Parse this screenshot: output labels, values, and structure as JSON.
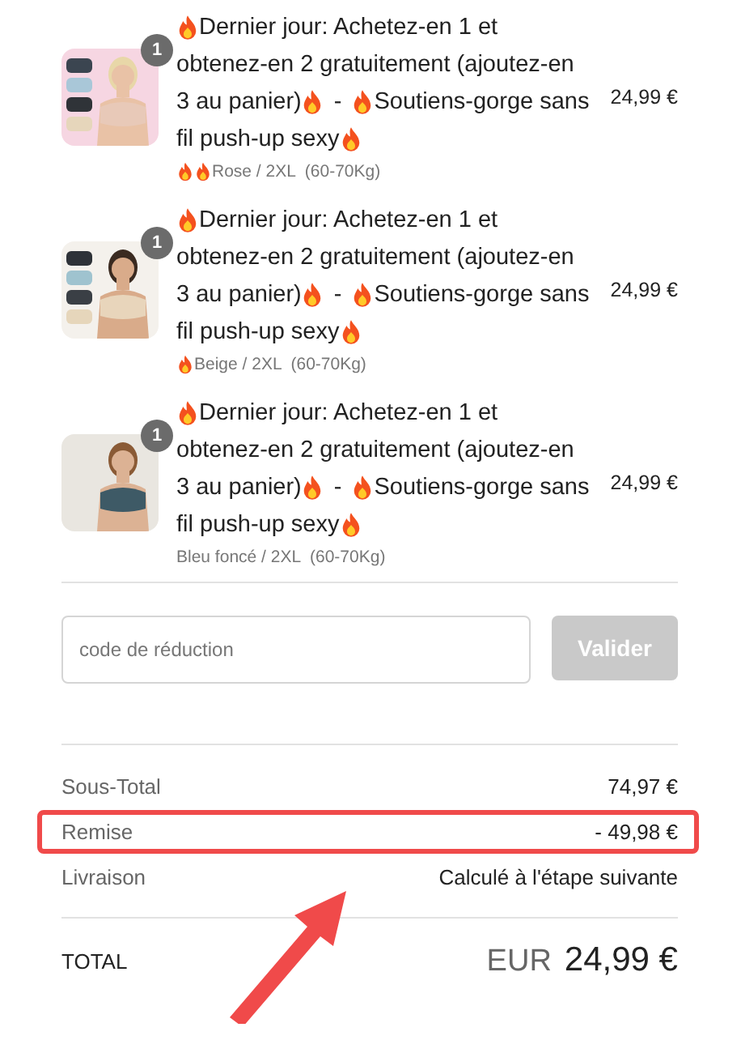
{
  "products": [
    {
      "kind": "picture",
      "quantity": "1",
      "title_lines": [
        [
          {
            "kind": "flame"
          },
          {
            "kind": "text",
            "text": "Dernier jour: Achetez-en 1 et"
          }
        ],
        [
          {
            "kind": "text",
            "text": "obtenez-en 2 gratuitement (ajoutez-en"
          }
        ],
        [
          {
            "kind": "text",
            "text": "3 au panier)"
          },
          {
            "kind": "flame"
          },
          {
            "kind": "text",
            "text": "-"
          },
          {
            "kind": "flame"
          },
          {
            "kind": "text",
            "text": "Soutiens-gorge sans"
          }
        ],
        [
          {
            "kind": "text",
            "text": "fil push-up sexy"
          },
          {
            "kind": "flame"
          }
        ]
      ],
      "variant": [
        {
          "kind": "flame"
        },
        {
          "kind": "flame"
        },
        {
          "kind": "text",
          "text": "Rose / 2XL  (60-70Kg)"
        }
      ],
      "price": "24,99 €"
    },
    {
      "kind": "picture",
      "quantity": "1",
      "title_lines": [
        [
          {
            "kind": "flame"
          },
          {
            "kind": "text",
            "text": "Dernier jour: Achetez-en 1 et"
          }
        ],
        [
          {
            "kind": "text",
            "text": "obtenez-en 2 gratuitement (ajoutez-en"
          }
        ],
        [
          {
            "kind": "text",
            "text": "3 au panier)"
          },
          {
            "kind": "flame"
          },
          {
            "kind": "text",
            "text": "-"
          },
          {
            "kind": "flame"
          },
          {
            "kind": "text",
            "text": "Soutiens-gorge sans"
          }
        ],
        [
          {
            "kind": "text",
            "text": "fil push-up sexy"
          },
          {
            "kind": "flame"
          }
        ]
      ],
      "variant": [
        {
          "kind": "flame"
        },
        {
          "kind": "text",
          "text": "Beige / 2XL  (60-70Kg)"
        }
      ],
      "price": "24,99 €"
    },
    {
      "kind": "picture",
      "quantity": "1",
      "title_lines": [
        [
          {
            "kind": "flame"
          },
          {
            "kind": "text",
            "text": "Dernier jour: Achetez-en 1 et"
          }
        ],
        [
          {
            "kind": "text",
            "text": "obtenez-en 2 gratuitement (ajoutez-en"
          }
        ],
        [
          {
            "kind": "text",
            "text": "3 au panier)"
          },
          {
            "kind": "flame"
          },
          {
            "kind": "text",
            "text": "-"
          },
          {
            "kind": "flame"
          },
          {
            "kind": "text",
            "text": "Soutiens-gorge sans"
          }
        ],
        [
          {
            "kind": "text",
            "text": "fil push-up sexy"
          },
          {
            "kind": "flame"
          }
        ]
      ],
      "variant": [
        {
          "kind": "text",
          "text": "Bleu foncé / 2XL  (60-70Kg)"
        }
      ],
      "price": "24,99 €"
    }
  ],
  "discount": {
    "placeholder": "code de réduction",
    "button": {
      "label": "Valider",
      "disabled": true
    }
  },
  "summary": [
    {
      "label": "Sous-Total",
      "value": "74,97 €",
      "highlighted": false
    },
    {
      "label": "Remise",
      "value": "- 49,98 €",
      "highlighted": true
    },
    {
      "label": "Livraison",
      "value": "Calculé à l'étape suivante",
      "highlighted": false
    }
  ],
  "total": {
    "label": "TOTAL",
    "currency": "EUR",
    "amount": "24,99 €"
  }
}
